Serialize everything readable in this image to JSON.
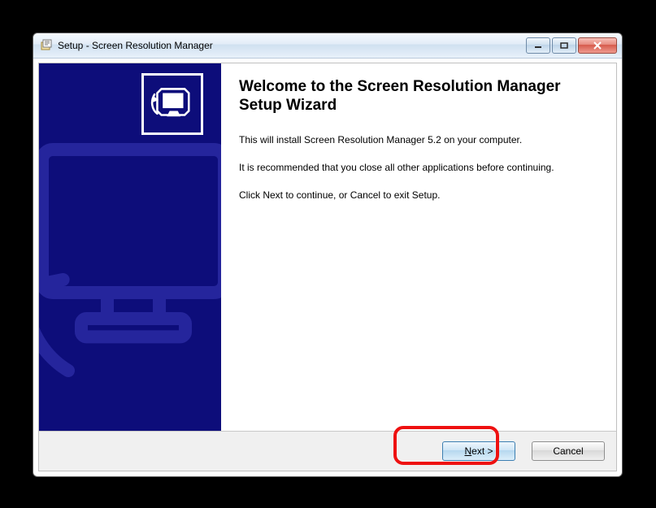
{
  "window": {
    "title": "Setup - Screen Resolution Manager"
  },
  "heading": "Welcome to the Screen Resolution Manager Setup Wizard",
  "body": {
    "p1": "This will install Screen Resolution Manager 5.2 on your computer.",
    "p2": "It is recommended that you close all other applications before continuing.",
    "p3": "Click Next to continue, or Cancel to exit Setup."
  },
  "buttons": {
    "next_prefix": "N",
    "next_rest": "ext >",
    "cancel": "Cancel"
  }
}
